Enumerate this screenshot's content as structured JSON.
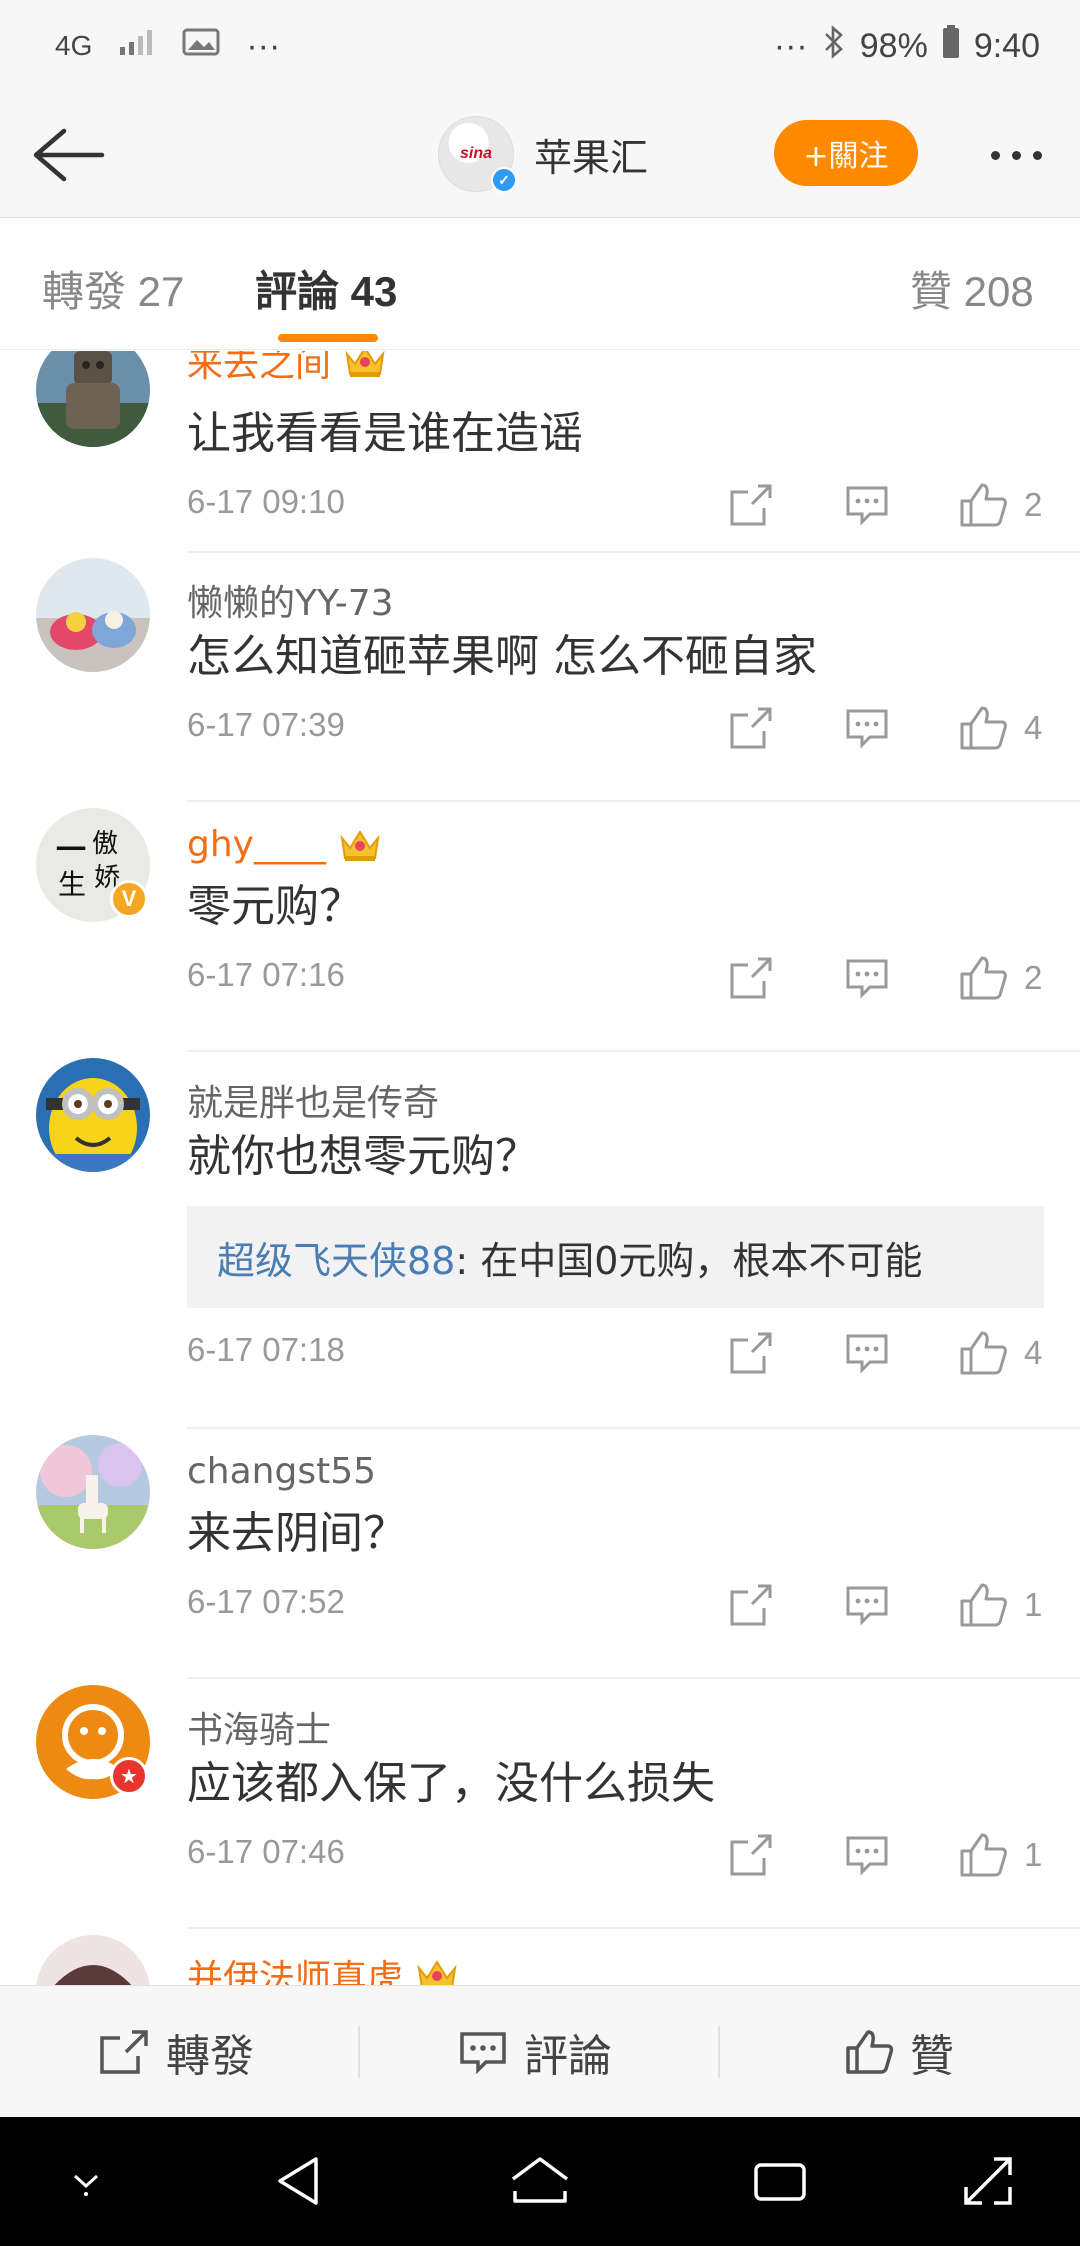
{
  "status_bar": {
    "network": "4G",
    "overflow": "···",
    "overflow_right": "···",
    "battery": "98%",
    "time": "9:40"
  },
  "nav": {
    "title": "苹果汇",
    "avatar_text": "sina",
    "follow_label": "+關注"
  },
  "tabs": [
    {
      "label": "轉發 27"
    },
    {
      "label": "評論 43"
    },
    {
      "label": "贊 208"
    }
  ],
  "comments": [
    {
      "user": "来去之间",
      "vip": true,
      "text": "让我看看是谁在造谣",
      "time": "6-17 09:10",
      "likes": "2"
    },
    {
      "user": "懒懒的YY-73",
      "vip": false,
      "text": "怎么知道砸苹果啊 怎么不砸自家",
      "time": "6-17 07:39",
      "likes": "4"
    },
    {
      "user": "ghy____",
      "vip": true,
      "text": "零元购？",
      "time": "6-17 07:16",
      "likes": "2"
    },
    {
      "user": "就是胖也是传奇",
      "vip": false,
      "text": "就你也想零元购？",
      "time": "6-17 07:18",
      "likes": "4",
      "reply": {
        "user": "超级飞天侠88",
        "text": ": 在中国0元购，根本不可能"
      }
    },
    {
      "user": "changst55",
      "vip": false,
      "text": "来去阴间？",
      "time": "6-17 07:52",
      "likes": "1"
    },
    {
      "user": "书海骑士",
      "vip": false,
      "text": "应该都入保了，没什么损失",
      "time": "6-17 07:46",
      "likes": "1"
    },
    {
      "user": "并伊法师真虎",
      "vip": true
    }
  ],
  "avatars": {
    "c1": "robot-avatar",
    "c2": "toys-avatar",
    "c3": "calligraphy-avatar",
    "c3_text": "一傲生娇",
    "c4": "minion-avatar",
    "c5": "llama-painting-avatar",
    "c6": "lion-logo-avatar"
  },
  "bottom_bar": {
    "repost": "轉發",
    "comment": "評論",
    "like": "贊"
  },
  "colors": {
    "accent": "#ff8a00",
    "vip_name": "#f26d13",
    "reply_user": "#4a7db3",
    "verified": "#2e9cf5"
  }
}
